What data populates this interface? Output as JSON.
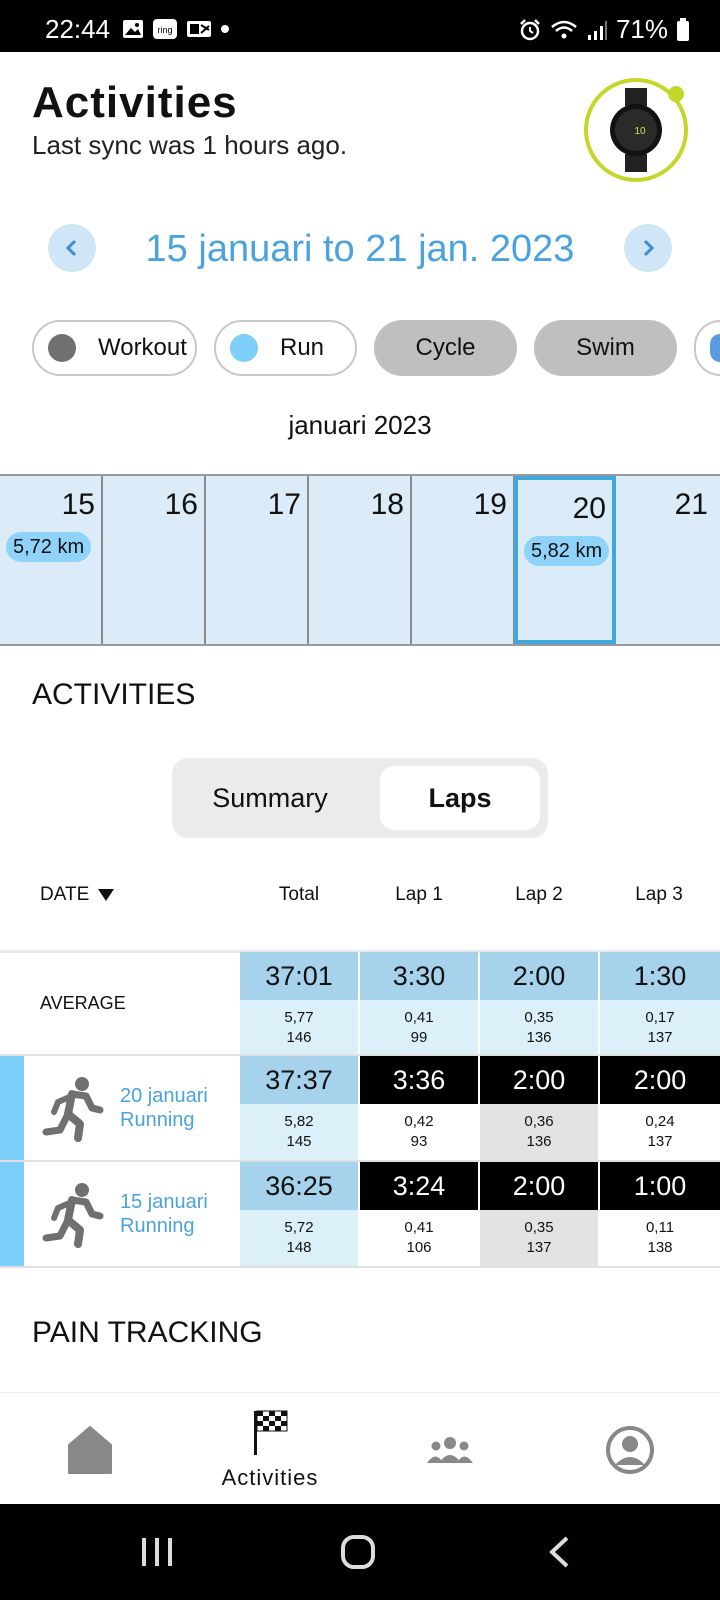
{
  "status_bar": {
    "time": "22:44",
    "battery": "71%"
  },
  "header": {
    "title": "Activities",
    "sync_text": "Last sync was 1 hours ago."
  },
  "date_nav": {
    "range": "15 januari to 21 jan. 2023",
    "prev": "‹",
    "next": "›"
  },
  "filters": [
    {
      "label": "Workout",
      "color": "#707070"
    },
    {
      "label": "Run",
      "color": "#7dcff9"
    },
    {
      "label": "Cycle"
    },
    {
      "label": "Swim"
    }
  ],
  "calendar": {
    "month": "januari 2023",
    "days": [
      {
        "num": "15",
        "km": "5,72 km"
      },
      {
        "num": "16"
      },
      {
        "num": "17"
      },
      {
        "num": "18"
      },
      {
        "num": "19"
      },
      {
        "num": "20",
        "km": "5,82 km",
        "selected": true
      },
      {
        "num": "21"
      }
    ]
  },
  "activities": {
    "heading": "ACTIVITIES",
    "segments": {
      "summary": "Summary",
      "laps": "Laps",
      "active": "Laps"
    },
    "columns": {
      "date": "DATE",
      "total": "Total",
      "lap1": "Lap 1",
      "lap2": "Lap 2",
      "lap3": "Lap 3"
    },
    "average": {
      "label": "AVERAGE",
      "total": {
        "time": "37:01",
        "dist": "5,77",
        "hr": "146"
      },
      "lap1": {
        "time": "3:30",
        "dist": "0,41",
        "hr": "99"
      },
      "lap2": {
        "time": "2:00",
        "dist": "0,35",
        "hr": "136"
      },
      "lap3": {
        "time": "1:30",
        "dist": "0,17",
        "hr": "137"
      }
    },
    "rows": [
      {
        "date": "20 januari",
        "type": "Running",
        "total": {
          "time": "37:37",
          "dist": "5,82",
          "hr": "145"
        },
        "lap1": {
          "time": "3:36",
          "dist": "0,42",
          "hr": "93"
        },
        "lap2": {
          "time": "2:00",
          "dist": "0,36",
          "hr": "136"
        },
        "lap3": {
          "time": "2:00",
          "dist": "0,24",
          "hr": "137"
        }
      },
      {
        "date": "15 januari",
        "type": "Running",
        "total": {
          "time": "36:25",
          "dist": "5,72",
          "hr": "148"
        },
        "lap1": {
          "time": "3:24",
          "dist": "0,41",
          "hr": "106"
        },
        "lap2": {
          "time": "2:00",
          "dist": "0,35",
          "hr": "137"
        },
        "lap3": {
          "time": "1:00",
          "dist": "0,11",
          "hr": "138"
        }
      }
    ]
  },
  "pain_tracking": {
    "heading": "PAIN TRACKING"
  },
  "bottom_nav": {
    "activities_label": "Activities"
  },
  "colors": {
    "accent_blue": "#4aa3de",
    "watch_ring": "#c5d62a",
    "run": "#7dcff9"
  }
}
